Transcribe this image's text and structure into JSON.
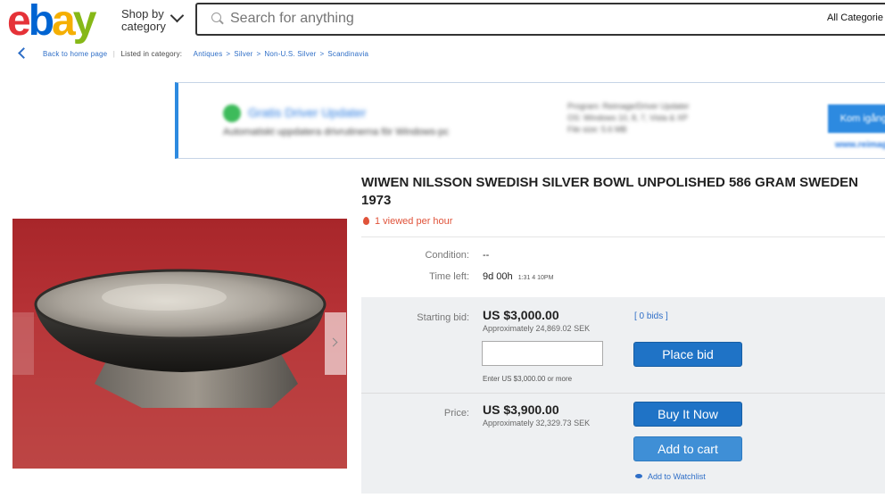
{
  "header": {
    "logo": [
      "e",
      "b",
      "a",
      "y"
    ],
    "logo_colors": [
      "#e53238",
      "#0064d2",
      "#f5af02",
      "#86b817"
    ],
    "shop_by": "Shop by category",
    "search_placeholder": "Search for anything",
    "all_categories": "All Categorie"
  },
  "breadcrumb": {
    "back": "Back to home page",
    "listed_in": "Listed in category:",
    "items": [
      "Antiques",
      "Silver",
      "Non-U.S. Silver",
      "Scandinavia"
    ]
  },
  "ad": {
    "title": "Gratis Driver Updater",
    "description": "Automatiskt uppdatera drivrutinerna för Windows-pc",
    "meta": [
      "Program: Reimage/Driver Updater",
      "OS: Windows 10, 8, 7, Vista & XP",
      "File size: 5.6 MB"
    ],
    "button": "Kom igång",
    "link": "www.reimage.com"
  },
  "listing": {
    "title": "WIWEN NILSSON SWEDISH SILVER BOWL UNPOLISHED 586 GRAM SWEDEN 1973",
    "viewed": "1 viewed per hour",
    "condition_label": "Condition:",
    "condition_value": "--",
    "time_left_label": "Time left:",
    "time_left_value": "9d 00h",
    "time_left_detail": "1:31 4 10PM"
  },
  "bid": {
    "starting_label": "Starting bid:",
    "starting_price": "US $3,000.00",
    "starting_approx": "Approximately 24,869.02 SEK",
    "bids_link": "[ 0 bids ]",
    "input_hint": "Enter US $3,000.00 or more",
    "place_bid": "Place bid"
  },
  "buy": {
    "price_label": "Price:",
    "price": "US $3,900.00",
    "price_approx": "Approximately 32,329.73 SEK",
    "buy_now": "Buy It Now",
    "add_to_cart": "Add to cart",
    "watchlist": "Add to Watchlist"
  },
  "colors": {
    "accent": "#1f73c6",
    "link": "#2e6ec7",
    "viewed": "#e0533a"
  }
}
